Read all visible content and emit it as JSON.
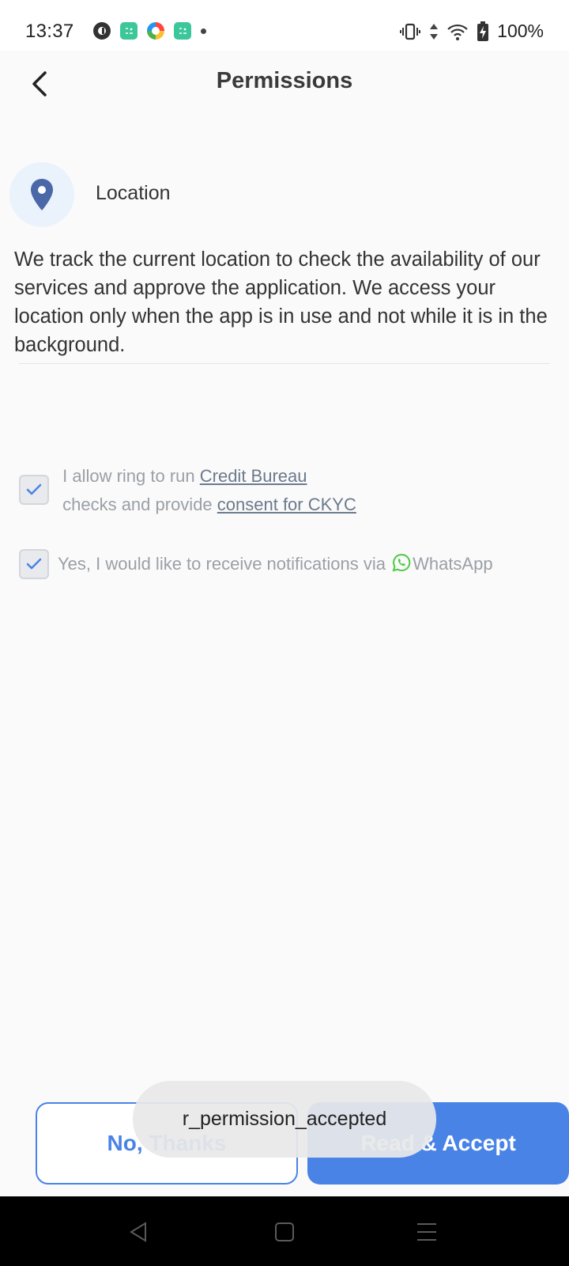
{
  "status_bar": {
    "time": "13:37",
    "battery": "100%",
    "icons": [
      "app-icon",
      "calculator-app-icon",
      "multicolor-app-icon",
      "calculator-app-icon",
      "notification-dot",
      "vibrate-icon",
      "data-arrows-icon",
      "wifi-icon",
      "battery-charging-icon"
    ]
  },
  "header": {
    "title": "Permissions",
    "back_icon": "chevron-left-icon"
  },
  "location": {
    "title": "Location",
    "icon": "map-pin-icon",
    "description": "We track the current location to check the availability of our services and approve the application. We access your location only when the app is in use and not while it is in the background."
  },
  "consents": {
    "credit": {
      "checked": true,
      "prefix": " I allow ring to run ",
      "link1": "Credit Bureau",
      "middle": " checks and provide ",
      "link2": "consent for CKYC"
    },
    "whatsapp": {
      "checked": true,
      "prefix": "Yes, I would like to receive notifications via ",
      "app_name": "WhatsApp"
    }
  },
  "buttons": {
    "decline": "No, Thanks",
    "accept": "Read & Accept"
  },
  "toast": "r_permission_accepted",
  "colors": {
    "accent": "#4a83e6",
    "whatsapp": "#4cca42",
    "pin": "#4a67a8"
  }
}
